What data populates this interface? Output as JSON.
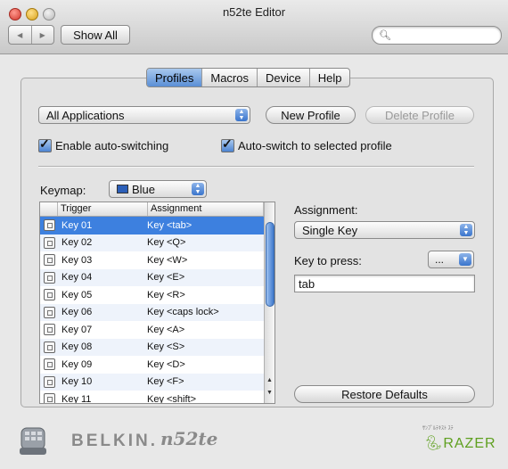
{
  "window": {
    "title": "n52te Editor"
  },
  "toolbar": {
    "show_all": "Show All",
    "search_placeholder": ""
  },
  "tabs": [
    {
      "label": "Profiles",
      "active": true
    },
    {
      "label": "Macros",
      "active": false
    },
    {
      "label": "Device",
      "active": false
    },
    {
      "label": "Help",
      "active": false
    }
  ],
  "profiles": {
    "application_select": "All Applications",
    "new_profile": "New Profile",
    "delete_profile": "Delete Profile",
    "enable_auto_switching": "Enable auto-switching",
    "auto_switch_selected": "Auto-switch to selected profile"
  },
  "keymap": {
    "label": "Keymap:",
    "value": "Blue",
    "swatch_color": "#2c5fb8"
  },
  "table": {
    "columns": [
      "Trigger",
      "Assignment"
    ],
    "rows": [
      {
        "trigger": "Key 01",
        "assignment": "Key <tab>",
        "selected": true
      },
      {
        "trigger": "Key 02",
        "assignment": "Key <Q>"
      },
      {
        "trigger": "Key 03",
        "assignment": "Key <W>"
      },
      {
        "trigger": "Key 04",
        "assignment": "Key <E>"
      },
      {
        "trigger": "Key 05",
        "assignment": "Key <R>"
      },
      {
        "trigger": "Key 06",
        "assignment": "Key <caps lock>"
      },
      {
        "trigger": "Key 07",
        "assignment": "Key <A>"
      },
      {
        "trigger": "Key 08",
        "assignment": "Key <S>"
      },
      {
        "trigger": "Key 09",
        "assignment": "Key <D>"
      },
      {
        "trigger": "Key 10",
        "assignment": "Key <F>"
      },
      {
        "trigger": "Key 11",
        "assignment": "Key <shift>"
      }
    ]
  },
  "assignment": {
    "label": "Assignment:",
    "value": "Single Key",
    "key_to_press_label": "Key to press:",
    "key_button": "...",
    "key_value": "tab",
    "restore_defaults": "Restore Defaults"
  },
  "footer": {
    "brand": "BELKIN.",
    "product": "n52te",
    "partner": "RAZER",
    "partner_small": "ｻﾝﾌﾟﾙﾃｷｽﾄ ｽﾃ"
  }
}
